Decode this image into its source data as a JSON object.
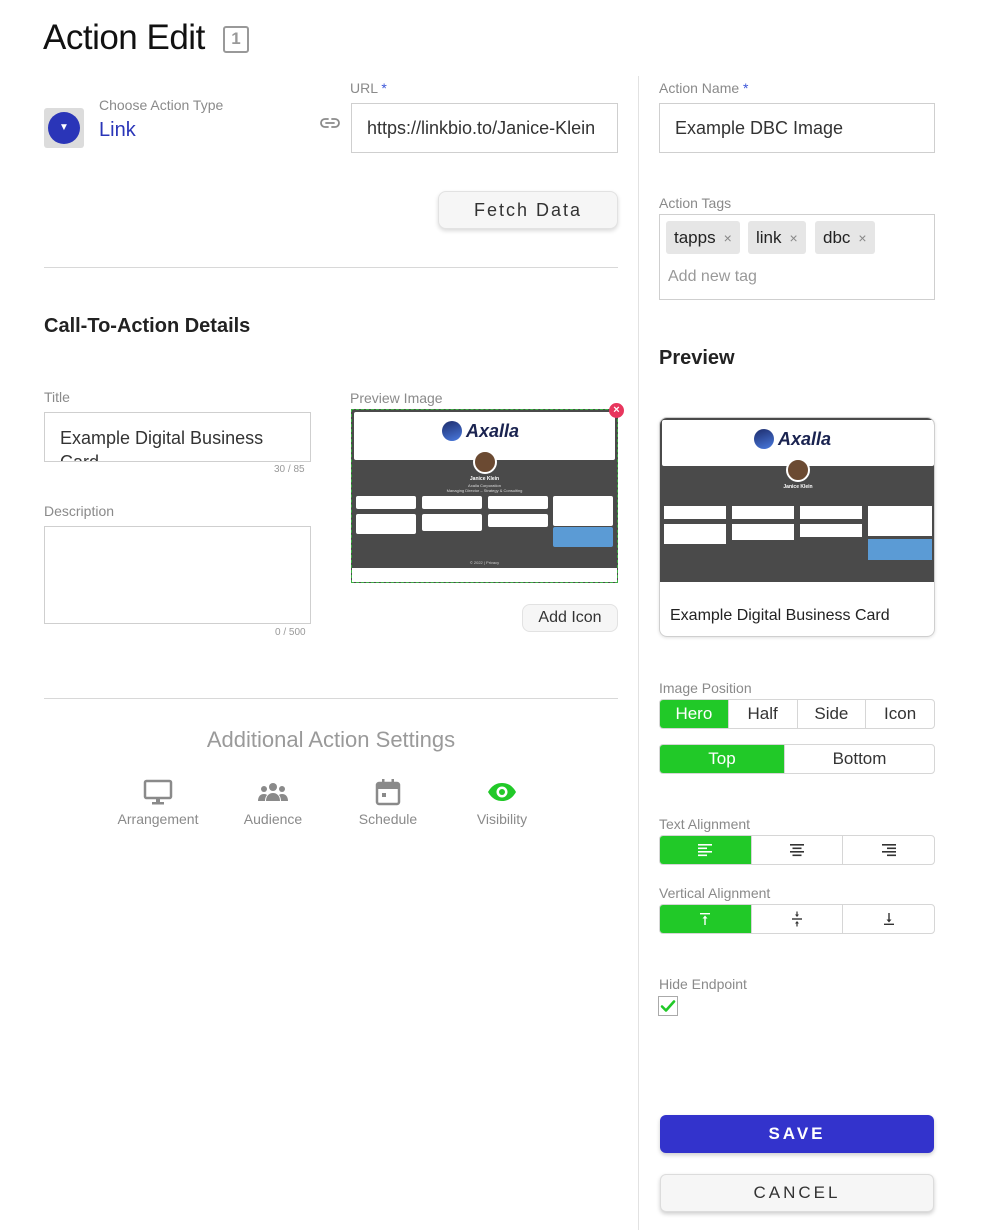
{
  "header": {
    "title": "Action Edit",
    "badge": "1"
  },
  "action_type": {
    "label": "Choose Action Type",
    "value": "Link"
  },
  "url": {
    "label": "URL",
    "required_mark": "*",
    "value": "https://linkbio.to/Janice-Klein"
  },
  "fetch_button": "Fetch Data",
  "cta": {
    "section_title": "Call-To-Action Details",
    "title_label": "Title",
    "title_value": "Example Digital Business Card",
    "title_counter": "30 / 85",
    "description_label": "Description",
    "description_value": "",
    "description_counter": "0 / 500",
    "preview_image_label": "Preview Image",
    "add_icon_button": "Add Icon"
  },
  "preview_card_image": {
    "brand": "Axalla",
    "name": "Janice Klein",
    "company": "Axalla Corporation",
    "role": "Managing Director – Strategy & Consulting",
    "footer": "© 2022 | Privacy"
  },
  "additional_settings": {
    "title": "Additional Action Settings",
    "items": [
      {
        "label": "Arrangement",
        "icon": "monitor-icon"
      },
      {
        "label": "Audience",
        "icon": "people-icon"
      },
      {
        "label": "Schedule",
        "icon": "calendar-icon"
      },
      {
        "label": "Visibility",
        "icon": "eye-icon",
        "active": true
      }
    ]
  },
  "action_name": {
    "label": "Action Name",
    "required_mark": "*",
    "value": "Example DBC Image"
  },
  "action_tags": {
    "label": "Action Tags",
    "tags": [
      "tapps",
      "link",
      "dbc"
    ],
    "remove_glyph": "×",
    "placeholder": "Add new tag"
  },
  "preview": {
    "title": "Preview",
    "card_title": "Example Digital Business Card"
  },
  "image_position": {
    "label": "Image Position",
    "options": [
      "Hero",
      "Half",
      "Side",
      "Icon"
    ],
    "selected": "Hero",
    "vertical_options": [
      "Top",
      "Bottom"
    ],
    "vertical_selected": "Top"
  },
  "text_alignment": {
    "label": "Text Alignment",
    "options": [
      "align-left-icon",
      "align-center-icon",
      "align-right-icon"
    ],
    "selected": "align-left-icon"
  },
  "vertical_alignment": {
    "label": "Vertical Alignment",
    "options": [
      "align-top-icon",
      "align-middle-icon",
      "align-bottom-icon"
    ],
    "selected": "align-top-icon"
  },
  "hide_endpoint": {
    "label": "Hide Endpoint",
    "checked": true
  },
  "buttons": {
    "save": "SAVE",
    "cancel": "CANCEL"
  },
  "colors": {
    "accent": "#21c928",
    "primary": "#3333cc",
    "link": "#2a35b8",
    "danger": "#e8365d"
  }
}
